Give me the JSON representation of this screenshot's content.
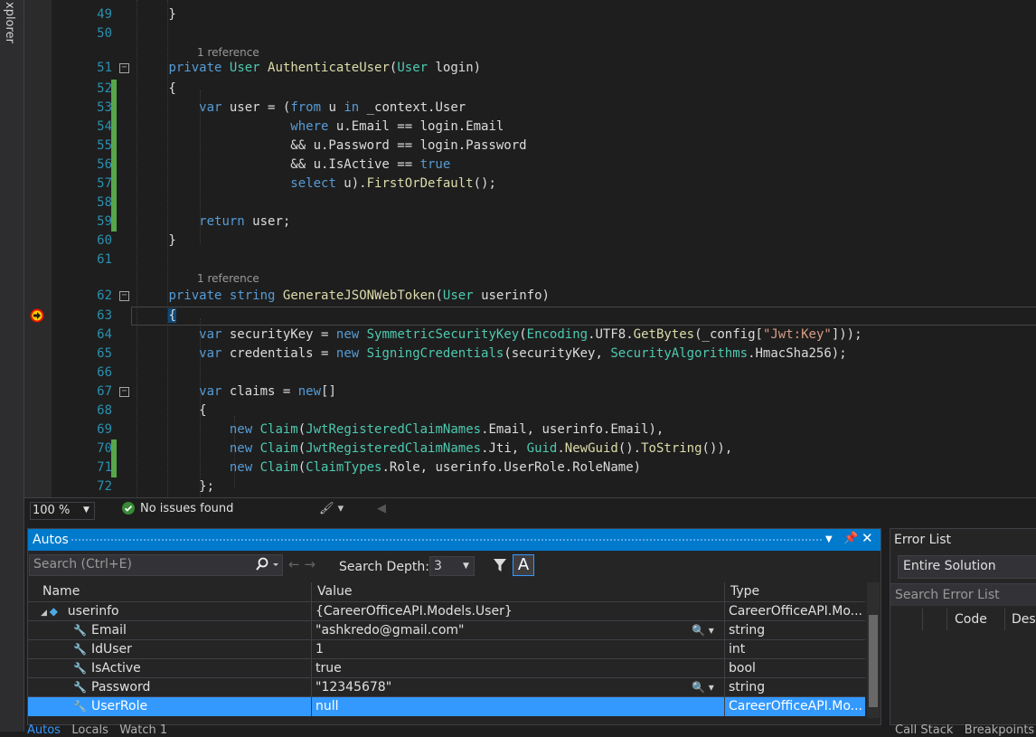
{
  "left_panel": {
    "label": "xplorer"
  },
  "editor": {
    "lines": [
      {
        "n": "49",
        "kind": "code",
        "html": "        }"
      },
      {
        "n": "50",
        "kind": "code",
        "html": ""
      },
      {
        "n": "",
        "kind": "lens",
        "text": "1 reference"
      },
      {
        "n": "51",
        "kind": "code",
        "fold": true,
        "html": "        <span class=\"kw\">private</span> <span class=\"ty\">User</span> <span class=\"mt\">AuthenticateUser</span>(<span class=\"ty\">User</span> login)"
      },
      {
        "n": "52",
        "kind": "code",
        "chg": true,
        "html": "        {"
      },
      {
        "n": "53",
        "kind": "code",
        "chg": true,
        "html": "            <span class=\"kw\">var</span> user = (<span class=\"kw\">from</span> u <span class=\"kw\">in</span> _context.User"
      },
      {
        "n": "54",
        "kind": "code",
        "chg": true,
        "html": "                        <span class=\"kw\">where</span> u.Email == login.Email"
      },
      {
        "n": "55",
        "kind": "code",
        "chg": true,
        "html": "                        &amp;&amp; u.Password == login.Password"
      },
      {
        "n": "56",
        "kind": "code",
        "chg": true,
        "html": "                        &amp;&amp; u.IsActive == <span class=\"kw\">true</span>"
      },
      {
        "n": "57",
        "kind": "code",
        "chg": true,
        "html": "                        <span class=\"kw\">select</span> u).<span class=\"mt\">FirstOrDefault</span>();"
      },
      {
        "n": "58",
        "kind": "code",
        "chg": true,
        "html": ""
      },
      {
        "n": "59",
        "kind": "code",
        "chg": true,
        "html": "            <span class=\"kw\">return</span> user;"
      },
      {
        "n": "60",
        "kind": "code",
        "html": "        }"
      },
      {
        "n": "61",
        "kind": "code",
        "html": ""
      },
      {
        "n": "",
        "kind": "lens",
        "text": "1 reference"
      },
      {
        "n": "62",
        "kind": "code",
        "fold": true,
        "html": "        <span class=\"kw\">private</span> <span class=\"kw\">string</span> <span class=\"mt\">GenerateJSONWebToken</span>(<span class=\"ty\">User</span> userinfo)"
      },
      {
        "n": "63",
        "kind": "code",
        "current": true,
        "html": "        <span class=\"brace-hl\">{</span>"
      },
      {
        "n": "64",
        "kind": "code",
        "html": "            <span class=\"kw\">var</span> securityKey = <span class=\"kw\">new</span> <span class=\"ty\">SymmetricSecurityKey</span>(<span class=\"ty\">Encoding</span>.UTF8.<span class=\"mt\">GetBytes</span>(_config[<span class=\"st\">\"Jwt:Key\"</span>]));"
      },
      {
        "n": "65",
        "kind": "code",
        "html": "            <span class=\"kw\">var</span> credentials = <span class=\"kw\">new</span> <span class=\"ty\">SigningCredentials</span>(securityKey, <span class=\"ty\">SecurityAlgorithms</span>.HmacSha256);"
      },
      {
        "n": "66",
        "kind": "code",
        "html": ""
      },
      {
        "n": "67",
        "kind": "code",
        "fold": true,
        "html": "            <span class=\"kw\">var</span> claims = <span class=\"kw\">new</span>[]"
      },
      {
        "n": "68",
        "kind": "code",
        "html": "            {"
      },
      {
        "n": "69",
        "kind": "code",
        "html": "                <span class=\"kw\">new</span> <span class=\"ty\">Claim</span>(<span class=\"ty\">JwtRegisteredClaimNames</span>.Email, userinfo.Email),"
      },
      {
        "n": "70",
        "kind": "code",
        "chg": true,
        "html": "                <span class=\"kw\">new</span> <span class=\"ty\">Claim</span>(<span class=\"ty\">JwtRegisteredClaimNames</span>.Jti, <span class=\"ty\">Guid</span>.<span class=\"mt\">NewGuid</span>().<span class=\"mt\">ToString</span>()),"
      },
      {
        "n": "71",
        "kind": "code",
        "chg": true,
        "html": "                <span class=\"kw\">new</span> <span class=\"ty\">Claim</span>(<span class=\"ty\">ClaimTypes</span>.Role, userinfo.UserRole.RoleName)"
      },
      {
        "n": "72",
        "kind": "code",
        "html": "            };"
      }
    ]
  },
  "status": {
    "zoom": "100 %",
    "issues": "No issues found"
  },
  "autos": {
    "title": "Autos",
    "search_placeholder": "Search (Ctrl+E)",
    "depth_label": "Search Depth:",
    "depth_value": "3",
    "a_button": "A",
    "columns": {
      "name": "Name",
      "value": "Value",
      "type": "Type"
    },
    "rows": [
      {
        "name": "userinfo",
        "value": "{CareerOfficeAPI.Models.User}",
        "type": "CareerOfficeAPI.Mo...",
        "icon": "object-icon",
        "expander": "◢",
        "mag": false
      },
      {
        "name": "Email",
        "value": "\"ashkredo@gmail.com\"",
        "type": "string",
        "icon": "wrench-icon",
        "mag": true
      },
      {
        "name": "IdUser",
        "value": "1",
        "type": "int",
        "icon": "wrench-icon",
        "mag": false
      },
      {
        "name": "IsActive",
        "value": "true",
        "type": "bool",
        "icon": "wrench-icon",
        "mag": false
      },
      {
        "name": "Password",
        "value": "\"12345678\"",
        "type": "string",
        "icon": "wrench-icon",
        "mag": true
      },
      {
        "name": "UserRole",
        "value": "null",
        "type": "CareerOfficeAPI.Mo...",
        "icon": "wrench-icon",
        "mag": false,
        "selected": true
      }
    ],
    "tabs": [
      "Autos",
      "Locals",
      "Watch 1"
    ]
  },
  "error_list": {
    "title": "Error List",
    "scope": "Entire Solution",
    "search_placeholder": "Search Error List",
    "col_code": "Code",
    "col_desc": "Desc",
    "tabs": [
      "Call Stack",
      "Breakpoints"
    ]
  },
  "colors": {
    "accent": "#007acc",
    "selection": "#3399ff",
    "change_bar": "#57a64a"
  }
}
